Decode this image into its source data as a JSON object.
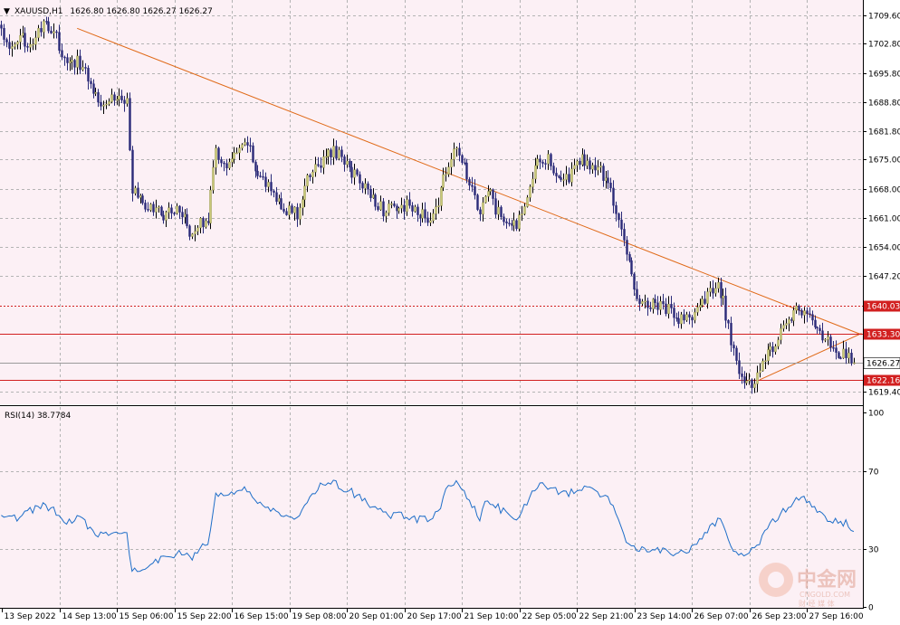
{
  "header": {
    "symbol": "XAUUSD,H1",
    "ohlc": "1626.80 1626.80 1626.27 1626.27"
  },
  "rsi_header": "RSI(14) 38.7784",
  "watermark": {
    "brand": "中金网",
    "site": "CNGOLD.COM",
    "sub": "财 经 媒 体"
  },
  "colors": {
    "background": "#fcf0f5",
    "grid": "#b4b4b4",
    "candle": "#c8c878",
    "candle_dark": "#2a2a78",
    "trendline": "#e06a18",
    "level_line": "#d22020",
    "bid_line": "#9a9a9a",
    "rsi_line": "#1e6ec8"
  },
  "chart_data": [
    {
      "type": "candlestick",
      "name": "XAUUSD,H1",
      "ylim": [
        1616.5,
        1712.0
      ],
      "y_ticks": [
        "1709.60",
        "1702.80",
        "1695.80",
        "1688.80",
        "1681.80",
        "1675.00",
        "1668.00",
        "1661.00",
        "1654.00",
        "1647.20",
        "1619.40"
      ],
      "x_ticks": [
        "13 Sep 2022",
        "14 Sep 13:00",
        "15 Sep 06:00",
        "15 Sep 22:00",
        "16 Sep 15:00",
        "19 Sep 08:00",
        "20 Sep 01:00",
        "20 Sep 17:00",
        "21 Sep 10:00",
        "22 Sep 05:00",
        "22 Sep 21:00",
        "23 Sep 14:00",
        "26 Sep 07:00",
        "26 Sep 23:00",
        "27 Sep 16:00"
      ],
      "price_path": [
        [
          0,
          1706
        ],
        [
          4,
          1701
        ],
        [
          8,
          1704
        ],
        [
          12,
          1703
        ],
        [
          16,
          1707
        ],
        [
          20,
          1706
        ],
        [
          25,
          1697
        ],
        [
          29,
          1699
        ],
        [
          33,
          1695
        ],
        [
          37,
          1689
        ],
        [
          41,
          1690
        ],
        [
          45,
          1690
        ],
        [
          48,
          1689
        ],
        [
          50,
          1668
        ],
        [
          54,
          1664
        ],
        [
          58,
          1663
        ],
        [
          62,
          1662
        ],
        [
          66,
          1663
        ],
        [
          70,
          1662
        ],
        [
          73,
          1656
        ],
        [
          76,
          1660
        ],
        [
          79,
          1661
        ],
        [
          82,
          1677
        ],
        [
          86,
          1673
        ],
        [
          90,
          1676
        ],
        [
          94,
          1679
        ],
        [
          97,
          1673
        ],
        [
          101,
          1669
        ],
        [
          105,
          1666
        ],
        [
          109,
          1663
        ],
        [
          113,
          1662
        ],
        [
          116,
          1668
        ],
        [
          119,
          1673
        ],
        [
          122,
          1674
        ],
        [
          126,
          1677
        ],
        [
          130,
          1676
        ],
        [
          134,
          1672
        ],
        [
          138,
          1669
        ],
        [
          142,
          1666
        ],
        [
          146,
          1663
        ],
        [
          150,
          1663
        ],
        [
          155,
          1664
        ],
        [
          159,
          1662
        ],
        [
          163,
          1661
        ],
        [
          167,
          1664
        ],
        [
          170,
          1673
        ],
        [
          174,
          1677
        ],
        [
          177,
          1674
        ],
        [
          180,
          1667
        ],
        [
          183,
          1662
        ],
        [
          186,
          1668
        ],
        [
          189,
          1663
        ],
        [
          193,
          1660
        ],
        [
          197,
          1659
        ],
        [
          201,
          1667
        ],
        [
          205,
          1676
        ],
        [
          209,
          1675
        ],
        [
          213,
          1671
        ],
        [
          217,
          1670
        ],
        [
          221,
          1675
        ],
        [
          225,
          1674
        ],
        [
          229,
          1672
        ],
        [
          233,
          1668
        ],
        [
          236,
          1660
        ],
        [
          239,
          1652
        ],
        [
          243,
          1642
        ],
        [
          247,
          1641
        ],
        [
          251,
          1640
        ],
        [
          255,
          1639
        ],
        [
          259,
          1636
        ],
        [
          263,
          1637
        ],
        [
          267,
          1639
        ],
        [
          271,
          1643
        ],
        [
          274,
          1644
        ],
        [
          276,
          1641
        ],
        [
          279,
          1631
        ],
        [
          282,
          1624
        ],
        [
          285,
          1621
        ],
        [
          288,
          1622
        ],
        [
          291,
          1626
        ],
        [
          295,
          1630
        ],
        [
          298,
          1634
        ],
        [
          301,
          1637
        ],
        [
          304,
          1639
        ],
        [
          308,
          1638
        ],
        [
          312,
          1634
        ],
        [
          316,
          1631
        ],
        [
          320,
          1629
        ],
        [
          324,
          1628
        ],
        [
          326,
          1626
        ]
      ],
      "last_price": 1626.27,
      "horizontal_levels": [
        1640.03,
        1633.3,
        1622.16
      ],
      "horizontal_level_labels": [
        "1640.03",
        "1633.30",
        "1622.16"
      ],
      "bid_label": "1626.27",
      "trendlines": [
        [
          [
            29,
            1706.5
          ],
          [
            329,
            1633.0
          ]
        ],
        [
          [
            290,
            1622.16
          ],
          [
            329,
            1633.3
          ]
        ]
      ]
    },
    {
      "type": "line",
      "name": "RSI(14)",
      "value": 38.7784,
      "ylim": [
        0,
        100
      ],
      "y_ticks": [
        100,
        70,
        30,
        0
      ],
      "values": [
        [
          0,
          46
        ],
        [
          4,
          45
        ],
        [
          8,
          47
        ],
        [
          12,
          50
        ],
        [
          16,
          52
        ],
        [
          20,
          50
        ],
        [
          25,
          44
        ],
        [
          29,
          46
        ],
        [
          33,
          42
        ],
        [
          37,
          37
        ],
        [
          41,
          38
        ],
        [
          45,
          36
        ],
        [
          48,
          38
        ],
        [
          50,
          18
        ],
        [
          54,
          20
        ],
        [
          58,
          22
        ],
        [
          62,
          26
        ],
        [
          66,
          27
        ],
        [
          70,
          28
        ],
        [
          73,
          24
        ],
        [
          76,
          30
        ],
        [
          79,
          32
        ],
        [
          82,
          58
        ],
        [
          86,
          56
        ],
        [
          90,
          60
        ],
        [
          94,
          61
        ],
        [
          97,
          55
        ],
        [
          101,
          51
        ],
        [
          105,
          50
        ],
        [
          109,
          47
        ],
        [
          113,
          45
        ],
        [
          116,
          53
        ],
        [
          119,
          58
        ],
        [
          122,
          62
        ],
        [
          126,
          64
        ],
        [
          130,
          62
        ],
        [
          134,
          59
        ],
        [
          138,
          55
        ],
        [
          142,
          51
        ],
        [
          146,
          48
        ],
        [
          150,
          47
        ],
        [
          155,
          47
        ],
        [
          159,
          45
        ],
        [
          163,
          45
        ],
        [
          167,
          48
        ],
        [
          170,
          60
        ],
        [
          174,
          64
        ],
        [
          177,
          59
        ],
        [
          180,
          52
        ],
        [
          183,
          46
        ],
        [
          186,
          56
        ],
        [
          189,
          52
        ],
        [
          193,
          48
        ],
        [
          197,
          46
        ],
        [
          201,
          53
        ],
        [
          205,
          63
        ],
        [
          209,
          62
        ],
        [
          213,
          59
        ],
        [
          217,
          58
        ],
        [
          221,
          62
        ],
        [
          225,
          60
        ],
        [
          229,
          58
        ],
        [
          233,
          54
        ],
        [
          236,
          46
        ],
        [
          239,
          34
        ],
        [
          243,
          28
        ],
        [
          247,
          30
        ],
        [
          251,
          29
        ],
        [
          255,
          28
        ],
        [
          259,
          28
        ],
        [
          263,
          30
        ],
        [
          267,
          34
        ],
        [
          271,
          40
        ],
        [
          274,
          45
        ],
        [
          276,
          42
        ],
        [
          279,
          33
        ],
        [
          282,
          26
        ],
        [
          285,
          28
        ],
        [
          288,
          30
        ],
        [
          291,
          36
        ],
        [
          295,
          44
        ],
        [
          298,
          48
        ],
        [
          301,
          52
        ],
        [
          304,
          56
        ],
        [
          308,
          55
        ],
        [
          312,
          50
        ],
        [
          316,
          45
        ],
        [
          320,
          44
        ],
        [
          324,
          43
        ],
        [
          326,
          39
        ]
      ]
    }
  ]
}
